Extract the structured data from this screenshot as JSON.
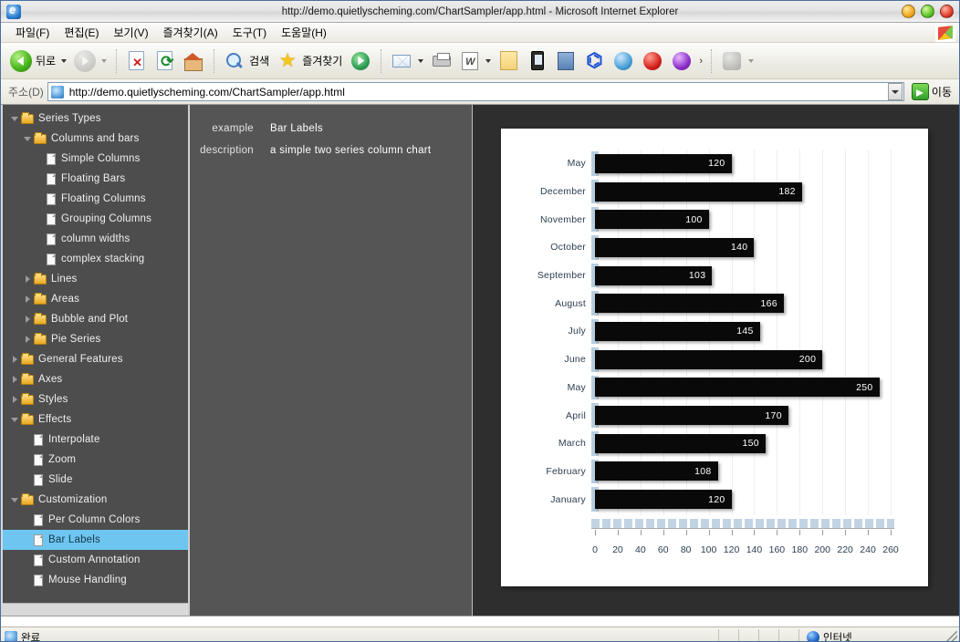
{
  "window": {
    "title": "http://demo.quietlyscheming.com/ChartSampler/app.html - Microsoft Internet Explorer",
    "app_icon": "ie-logo-icon",
    "buttons": {
      "minimize": "minimize-button",
      "maximize": "maximize-button",
      "close": "close-button"
    }
  },
  "menubar": {
    "items": [
      {
        "label": "파일(F)",
        "name": "menu-file"
      },
      {
        "label": "편집(E)",
        "name": "menu-edit"
      },
      {
        "label": "보기(V)",
        "name": "menu-view"
      },
      {
        "label": "즐겨찾기(A)",
        "name": "menu-favorites"
      },
      {
        "label": "도구(T)",
        "name": "menu-tools"
      },
      {
        "label": "도움말(H)",
        "name": "menu-help"
      }
    ]
  },
  "toolbar": {
    "back_label": "뒤로",
    "search_label": "검색",
    "favorites_label": "즐겨찾기",
    "more_label": "›",
    "icons": [
      "back-arrow-icon",
      "forward-arrow-icon",
      "stop-icon",
      "refresh-icon",
      "home-icon",
      "search-icon",
      "favorites-star-icon",
      "media-icon",
      "mail-icon",
      "print-icon",
      "word-edit-icon",
      "notes-icon",
      "messenger-icon",
      "research-icon",
      "bluetooth-icon",
      "globe-icon",
      "alert-icon",
      "yahoo-icon",
      "discuss-icon"
    ]
  },
  "addressbar": {
    "label": "주소(D)",
    "url": "http://demo.quietlyscheming.com/ChartSampler/app.html",
    "placeholder": "",
    "go_label": "이동"
  },
  "sidebar": {
    "items": [
      {
        "label": "Series Types",
        "type": "folder",
        "indent": 0,
        "expanded": true,
        "selected": false
      },
      {
        "label": "Columns and bars",
        "type": "folder",
        "indent": 1,
        "expanded": true,
        "selected": false
      },
      {
        "label": "Simple Columns",
        "type": "doc",
        "indent": 2,
        "selected": false
      },
      {
        "label": "Floating Bars",
        "type": "doc",
        "indent": 2,
        "selected": false
      },
      {
        "label": "Floating Columns",
        "type": "doc",
        "indent": 2,
        "selected": false
      },
      {
        "label": "Grouping Columns",
        "type": "doc",
        "indent": 2,
        "selected": false
      },
      {
        "label": "column widths",
        "type": "doc",
        "indent": 2,
        "selected": false
      },
      {
        "label": "complex stacking",
        "type": "doc",
        "indent": 2,
        "selected": false
      },
      {
        "label": "Lines",
        "type": "folder",
        "indent": 1,
        "expanded": false,
        "selected": false
      },
      {
        "label": "Areas",
        "type": "folder",
        "indent": 1,
        "expanded": false,
        "selected": false
      },
      {
        "label": "Bubble and Plot",
        "type": "folder",
        "indent": 1,
        "expanded": false,
        "selected": false
      },
      {
        "label": "Pie Series",
        "type": "folder",
        "indent": 1,
        "expanded": false,
        "selected": false
      },
      {
        "label": "General Features",
        "type": "folder",
        "indent": 0,
        "expanded": false,
        "selected": false
      },
      {
        "label": "Axes",
        "type": "folder",
        "indent": 0,
        "expanded": false,
        "selected": false
      },
      {
        "label": "Styles",
        "type": "folder",
        "indent": 0,
        "expanded": false,
        "selected": false
      },
      {
        "label": "Effects",
        "type": "folder",
        "indent": 0,
        "expanded": true,
        "selected": false
      },
      {
        "label": "Interpolate",
        "type": "doc",
        "indent": 1,
        "selected": false
      },
      {
        "label": "Zoom",
        "type": "doc",
        "indent": 1,
        "selected": false
      },
      {
        "label": "Slide",
        "type": "doc",
        "indent": 1,
        "selected": false
      },
      {
        "label": "Customization",
        "type": "folder",
        "indent": 0,
        "expanded": true,
        "selected": false
      },
      {
        "label": "Per Column Colors",
        "type": "doc",
        "indent": 1,
        "selected": false
      },
      {
        "label": "Bar Labels",
        "type": "doc",
        "indent": 1,
        "selected": true
      },
      {
        "label": "Custom Annotation",
        "type": "doc",
        "indent": 1,
        "selected": false
      },
      {
        "label": "Mouse Handling",
        "type": "doc",
        "indent": 1,
        "selected": false
      }
    ]
  },
  "details": {
    "example_key": "example",
    "example_value": "Bar Labels",
    "description_key": "description",
    "description_value": "a simple two series column chart"
  },
  "chart_data": {
    "type": "bar",
    "orientation": "horizontal",
    "title": "",
    "xlabel": "",
    "ylabel": "",
    "xlim": [
      0,
      260
    ],
    "xticks": [
      0,
      20,
      40,
      60,
      80,
      100,
      120,
      140,
      160,
      180,
      200,
      220,
      240,
      260
    ],
    "grid": true,
    "categories": [
      "May",
      "December",
      "November",
      "October",
      "September",
      "August",
      "July",
      "June",
      "May",
      "April",
      "March",
      "February",
      "January"
    ],
    "values": [
      120,
      182,
      100,
      140,
      103,
      166,
      145,
      200,
      250,
      170,
      150,
      108,
      120
    ],
    "bar_color": "#090909",
    "label_color": "#ffffff",
    "axis_band_color": "#c2d4e4"
  },
  "statusbar": {
    "status_text": "완료",
    "zone_text": "인터넷",
    "zone_icon": "internet-globe-icon",
    "page_icon": "ie-page-icon"
  }
}
